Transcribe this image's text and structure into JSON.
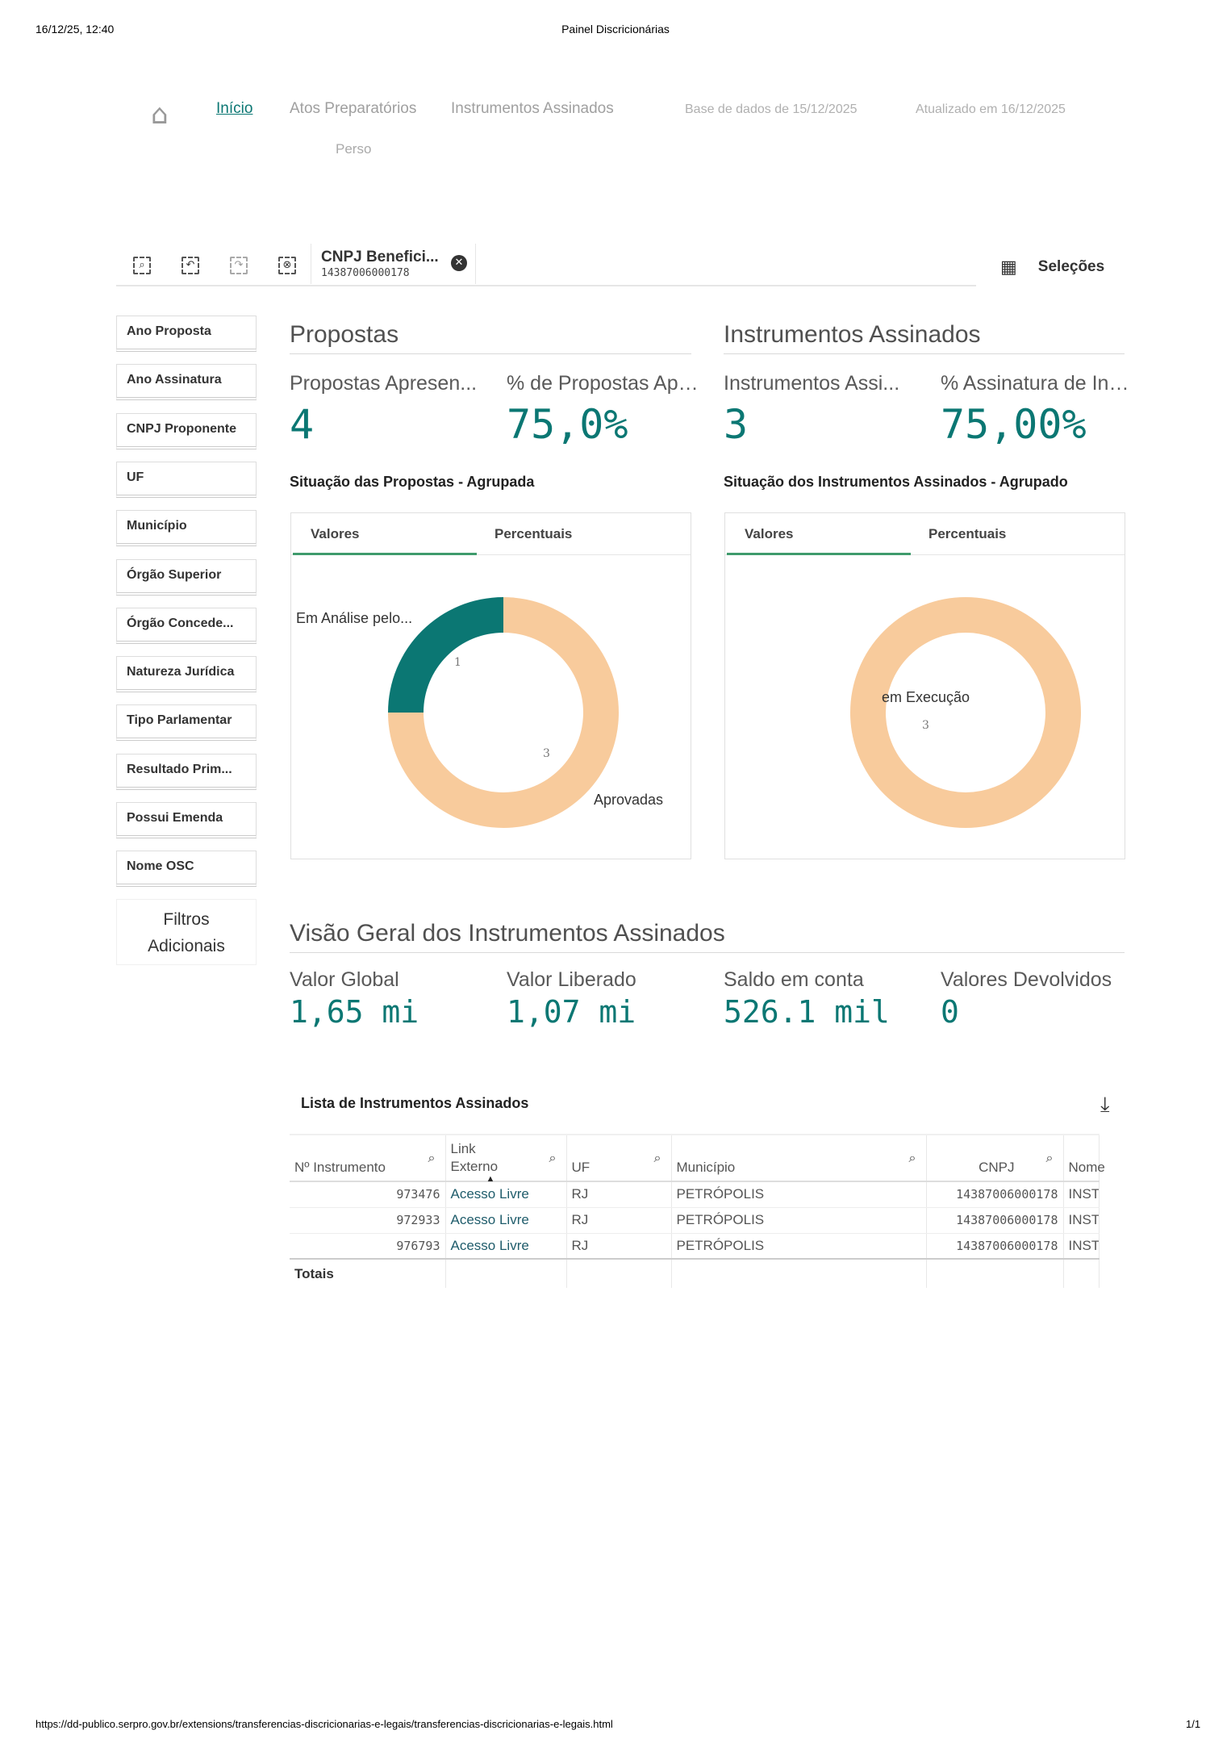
{
  "print_header": {
    "datetime": "16/12/25, 12:40",
    "title": "Painel Discricionárias"
  },
  "print_footer": {
    "url": "https://dd-publico.serpro.gov.br/extensions/transferencias-discricionarias-e-legais/transferencias-discricionarias-e-legais.html",
    "page": "1/1"
  },
  "nav": {
    "home_icon": "home-icon",
    "items": [
      "Início",
      "Atos Preparatórios",
      "Instrumentos Assinados"
    ],
    "base": "Base de dados de 15/12/2025",
    "updated": "Atualizado em 16/12/2025",
    "partial": "Perso"
  },
  "toolbar": {
    "selection_title": "CNPJ Benefici...",
    "selection_value": "14387006000178",
    "selections_label": "Seleções"
  },
  "sidebar": {
    "filters": [
      "Ano Proposta",
      "Ano Assinatura",
      "CNPJ Proponente",
      "UF",
      "Município",
      "Órgão Superior",
      "Órgão Concede...",
      "Natureza Jurídica",
      "Tipo Parlamentar",
      "Resultado Prim...",
      "Possui Emenda",
      "Nome OSC"
    ],
    "more_line1": "Filtros",
    "more_line2": "Adicionais"
  },
  "propostas": {
    "title": "Propostas",
    "kpi1_label": "Propostas Apresen...",
    "kpi1_value": "4",
    "kpi2_label": "% de Propostas Apr...",
    "kpi2_value": "75,0%",
    "chart_title": "Situação das Propostas - Agrupada",
    "tab1": "Valores",
    "tab2": "Percentuais"
  },
  "instrumentos": {
    "title": "Instrumentos Assinados",
    "kpi1_label": "Instrumentos Assi...",
    "kpi1_value": "3",
    "kpi2_label": "% Assinatura de Ins...",
    "kpi2_value": "75,00%",
    "chart_title": "Situação dos Instrumentos Assinados - Agrupado",
    "tab1": "Valores",
    "tab2": "Percentuais"
  },
  "chart_data": [
    {
      "type": "pie",
      "title": "Situação das Propostas - Agrupada",
      "labels": [
        "Em Análise pelo...",
        "Aprovadas"
      ],
      "values": [
        1,
        3
      ],
      "colors": [
        "#0b7773",
        "#f8cb9c"
      ]
    },
    {
      "type": "pie",
      "title": "Situação dos Instrumentos Assinados - Agrupado",
      "labels": [
        "em Execução"
      ],
      "values": [
        3
      ],
      "colors": [
        "#f8cb9c"
      ]
    }
  ],
  "visao": {
    "title": "Visão Geral dos Instrumentos Assinados",
    "kpis": [
      {
        "label": "Valor Global",
        "value": "1,65 mi"
      },
      {
        "label": "Valor Liberado",
        "value": "1,07 mi"
      },
      {
        "label": "Saldo em conta",
        "value": "526.1 mil"
      },
      {
        "label": "Valores Devolvidos",
        "value": "0"
      }
    ]
  },
  "lista": {
    "title": "Lista de Instrumentos Assinados",
    "columns": [
      "Nº Instrumento",
      "Link Externo",
      "UF",
      "Município",
      "CNPJ",
      "Nome"
    ],
    "rows": [
      [
        "973476",
        "Acesso Livre",
        "RJ",
        "PETRÓPOLIS",
        "14387006000178",
        "INST"
      ],
      [
        "972933",
        "Acesso Livre",
        "RJ",
        "PETRÓPOLIS",
        "14387006000178",
        "INST"
      ],
      [
        "976793",
        "Acesso Livre",
        "RJ",
        "PETRÓPOLIS",
        "14387006000178",
        "INST"
      ]
    ],
    "totals_label": "Totais"
  }
}
